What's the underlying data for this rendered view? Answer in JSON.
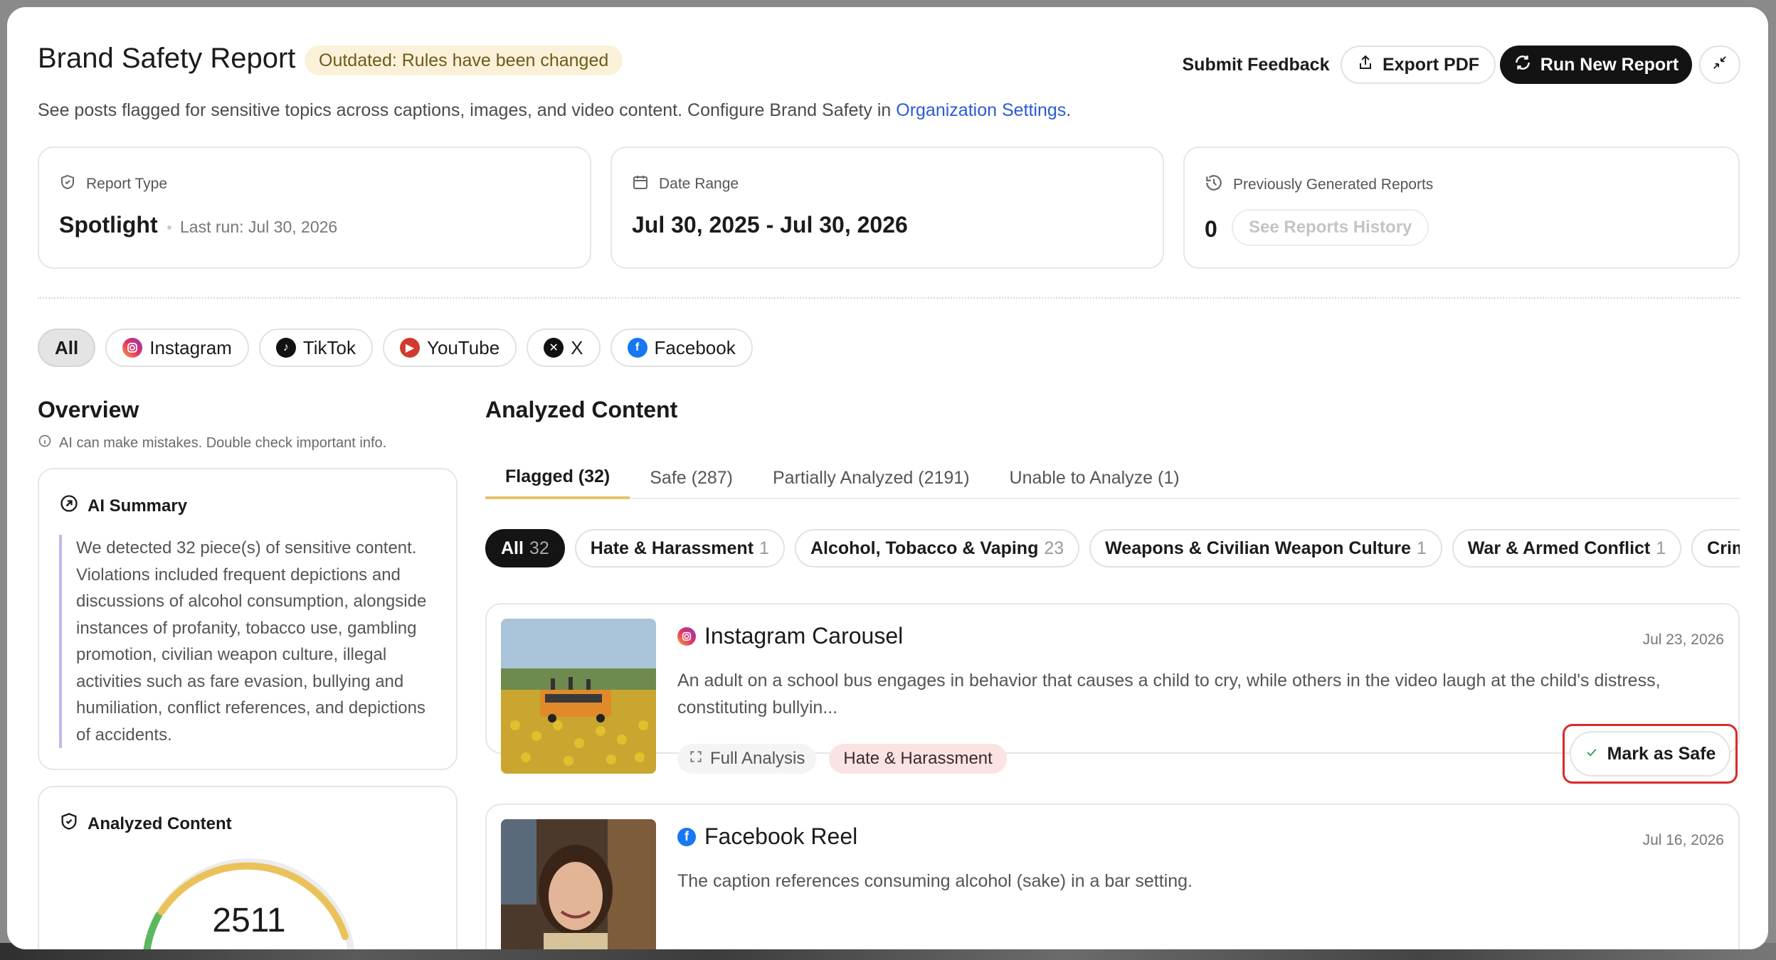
{
  "header": {
    "title": "Brand Safety Report",
    "outdated_badge": "Outdated: Rules have been changed",
    "subtitle": "See posts flagged for sensitive topics across captions, images, and video content. Configure Brand Safety in ",
    "subtitle_link": "Organization Settings",
    "subtitle_end": ".",
    "submit_feedback": "Submit Feedback",
    "export_pdf": "Export PDF",
    "run_new_report": "Run New Report"
  },
  "cards": {
    "report_type": {
      "label": "Report Type",
      "value": "Spotlight",
      "last_run": "Last run: Jul 30, 2026"
    },
    "date_range": {
      "label": "Date Range",
      "value": "Jul 30, 2025 - Jul 30, 2026"
    },
    "previous_reports": {
      "label": "Previously Generated Reports",
      "value": "0",
      "history_button": "See Reports History"
    }
  },
  "platforms": [
    "All",
    "Instagram",
    "TikTok",
    "YouTube",
    "X",
    "Facebook"
  ],
  "overview": {
    "title": "Overview",
    "note": "AI can make mistakes. Double check important info.",
    "ai_summary_title": "AI Summary",
    "ai_summary_text": "We detected 32 piece(s) of sensitive content. Violations included frequent depictions and discussions of alcohol consumption, alongside instances of profanity, tobacco use, gambling promotion, civilian weapon culture, illegal activities such as fare evasion, bullying and humiliation, conflict references, and depictions of accidents.",
    "analyzed_title": "Analyzed Content",
    "analyzed_total": "2511"
  },
  "analyzed": {
    "title": "Analyzed Content",
    "tabs": [
      "Flagged (32)",
      "Safe (287)",
      "Partially Analyzed (2191)",
      "Unable to Analyze (1)"
    ],
    "categories": [
      {
        "name": "All",
        "count": "32"
      },
      {
        "name": "Hate & Harassment",
        "count": "1"
      },
      {
        "name": "Alcohol, Tobacco & Vaping",
        "count": "23"
      },
      {
        "name": "Weapons & Civilian Weapon Culture",
        "count": "1"
      },
      {
        "name": "War & Armed Conflict",
        "count": "1"
      },
      {
        "name": "Crime & Il",
        "count": ""
      }
    ],
    "posts": [
      {
        "title": "Instagram Carousel",
        "date": "Jul 23, 2026",
        "description": "An adult on a school bus engages in behavior that causes a child to cry, while others in the video laugh at the child's distress, constituting bullyin...",
        "full_analysis": "Full Analysis",
        "tag": "Hate & Harassment",
        "action": "Mark as Safe"
      },
      {
        "title": "Facebook Reel",
        "date": "Jul 16, 2026",
        "description": "The caption references consuming alcohol (sake) in a bar setting."
      }
    ]
  },
  "colors": {
    "accent_link": "#2a5bd7",
    "badge_bg": "#fbf1d8",
    "tag_bg": "#fbe3e3",
    "highlight_outline": "#d92b2b",
    "tab_underline": "#e6c46c"
  }
}
